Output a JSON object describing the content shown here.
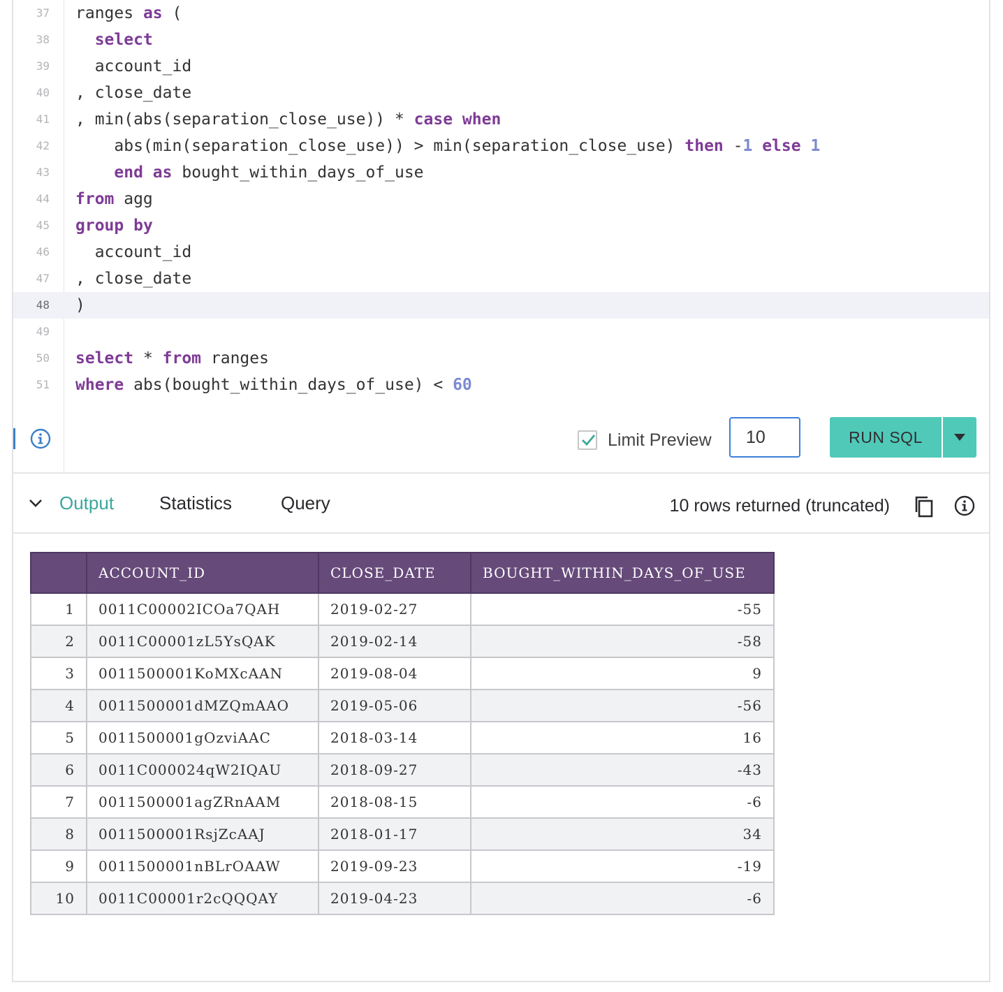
{
  "editor": {
    "lines": [
      {
        "no": "37",
        "tokens": [
          {
            "t": "ranges ",
            "c": ""
          },
          {
            "t": "as",
            "c": "kw"
          },
          {
            "t": " (",
            "c": ""
          }
        ]
      },
      {
        "no": "38",
        "tokens": [
          {
            "t": "  ",
            "c": ""
          },
          {
            "t": "select",
            "c": "kw"
          }
        ]
      },
      {
        "no": "39",
        "tokens": [
          {
            "t": "  account_id",
            "c": ""
          }
        ]
      },
      {
        "no": "40",
        "tokens": [
          {
            "t": ", close_date",
            "c": ""
          }
        ]
      },
      {
        "no": "41",
        "tokens": [
          {
            "t": ", min(abs(separation_close_use)) * ",
            "c": ""
          },
          {
            "t": "case",
            "c": "kw"
          },
          {
            "t": " ",
            "c": ""
          },
          {
            "t": "when",
            "c": "kw"
          }
        ]
      },
      {
        "no": "42",
        "tokens": [
          {
            "t": "    abs(min(separation_close_use)) > min(separation_close_use) ",
            "c": ""
          },
          {
            "t": "then",
            "c": "kw"
          },
          {
            "t": " -",
            "c": ""
          },
          {
            "t": "1",
            "c": "num"
          },
          {
            "t": " ",
            "c": ""
          },
          {
            "t": "else",
            "c": "kw"
          },
          {
            "t": " ",
            "c": ""
          },
          {
            "t": "1",
            "c": "num"
          }
        ]
      },
      {
        "no": "43",
        "tokens": [
          {
            "t": "    ",
            "c": ""
          },
          {
            "t": "end",
            "c": "kw"
          },
          {
            "t": " ",
            "c": ""
          },
          {
            "t": "as",
            "c": "kw"
          },
          {
            "t": " bought_within_days_of_use",
            "c": ""
          }
        ]
      },
      {
        "no": "44",
        "tokens": [
          {
            "t": "from",
            "c": "kw"
          },
          {
            "t": " agg",
            "c": ""
          }
        ]
      },
      {
        "no": "45",
        "tokens": [
          {
            "t": "group",
            "c": "kw"
          },
          {
            "t": " ",
            "c": ""
          },
          {
            "t": "by",
            "c": "kw"
          }
        ]
      },
      {
        "no": "46",
        "tokens": [
          {
            "t": "  account_id",
            "c": ""
          }
        ]
      },
      {
        "no": "47",
        "tokens": [
          {
            "t": ", close_date",
            "c": ""
          }
        ]
      },
      {
        "no": "48",
        "active": true,
        "tokens": [
          {
            "t": ")",
            "c": ""
          }
        ]
      },
      {
        "no": "49",
        "tokens": []
      },
      {
        "no": "50",
        "tokens": [
          {
            "t": "select",
            "c": "kw"
          },
          {
            "t": " * ",
            "c": ""
          },
          {
            "t": "from",
            "c": "kw"
          },
          {
            "t": " ranges",
            "c": ""
          }
        ]
      },
      {
        "no": "51",
        "tokens": [
          {
            "t": "where",
            "c": "kw"
          },
          {
            "t": " abs(bought_within_days_of_use) < ",
            "c": ""
          },
          {
            "t": "60",
            "c": "num"
          }
        ]
      }
    ]
  },
  "controls": {
    "limit_label": "Limit Preview",
    "limit_checked": true,
    "limit_value": "10",
    "run_label": "RUN SQL"
  },
  "tabs": {
    "items": [
      "Output",
      "Statistics",
      "Query"
    ],
    "active": "Output",
    "rows_status": "10 rows returned (truncated)"
  },
  "table": {
    "columns": [
      "",
      "ACCOUNT_ID",
      "CLOSE_DATE",
      "BOUGHT_WITHIN_DAYS_OF_USE"
    ],
    "rows": [
      [
        "1",
        "0011C00002ICOa7QAH",
        "2019-02-27",
        "-55"
      ],
      [
        "2",
        "0011C00001zL5YsQAK",
        "2019-02-14",
        "-58"
      ],
      [
        "3",
        "0011500001KoMXcAAN",
        "2019-08-04",
        "9"
      ],
      [
        "4",
        "0011500001dMZQmAAO",
        "2019-05-06",
        "-56"
      ],
      [
        "5",
        "0011500001gOzviAAC",
        "2018-03-14",
        "16"
      ],
      [
        "6",
        "0011C000024qW2IQAU",
        "2018-09-27",
        "-43"
      ],
      [
        "7",
        "0011500001agZRnAAM",
        "2018-08-15",
        "-6"
      ],
      [
        "8",
        "0011500001RsjZcAAJ",
        "2018-01-17",
        "34"
      ],
      [
        "9",
        "0011500001nBLrOAAW",
        "2019-09-23",
        "-19"
      ],
      [
        "10",
        "0011C00001r2cQQQAY",
        "2019-04-23",
        "-6"
      ]
    ]
  },
  "colors": {
    "keyword": "#7e3b96",
    "number": "#7c8bd0",
    "accent": "#50c9b8",
    "table_header": "#664a7a"
  }
}
